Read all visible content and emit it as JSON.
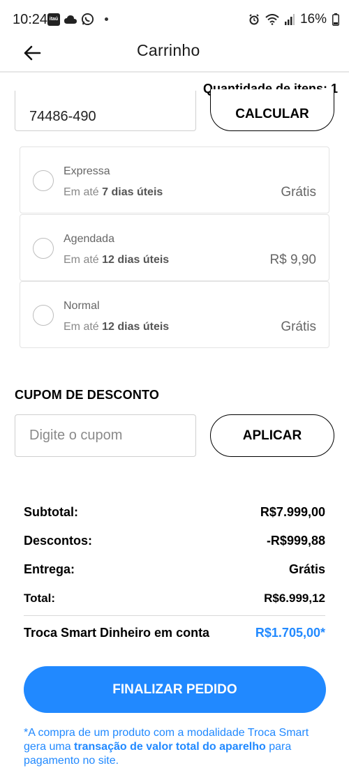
{
  "status_bar": {
    "time": "10:24",
    "itau_label": "itaú",
    "battery": "16%"
  },
  "header": {
    "title": "Carrinho"
  },
  "cart": {
    "quantity_label": "Quantidade de itens: 1"
  },
  "shipping": {
    "cep_value": "74486-490",
    "calculate_label": "CALCULAR",
    "options": [
      {
        "name": "Expressa",
        "eta_prefix": "Em até",
        "eta_days": "7 dias úteis",
        "price": "Grátis"
      },
      {
        "name": "Agendada",
        "eta_prefix": "Em até",
        "eta_days": "12 dias úteis",
        "price": "R$ 9,90"
      },
      {
        "name": "Normal",
        "eta_prefix": "Em até",
        "eta_days": "12 dias úteis",
        "price": "Grátis"
      }
    ]
  },
  "coupon": {
    "title": "CUPOM DE DESCONTO",
    "placeholder": "Digite o cupom",
    "apply_label": "APLICAR"
  },
  "summary": {
    "subtotal_label": "Subtotal:",
    "subtotal_value": "R$7.999,00",
    "discount_label": "Descontos:",
    "discount_value": "-R$999,88",
    "delivery_label": "Entrega:",
    "delivery_value": "Grátis",
    "total_label": "Total:",
    "total_value": "R$6.999,12",
    "trade_label": "Troca Smart Dinheiro em conta",
    "trade_value": "R$1.705,00*"
  },
  "finalize_label": "FINALIZAR PEDIDO",
  "note": {
    "part1": "*A compra de um produto com a modalidade Troca Smart gera uma ",
    "bold": "transação de valor total do aparelho",
    "part2": " para pagamento no site."
  },
  "colors": {
    "accent": "#2189ff",
    "border": "#cfcfcf"
  }
}
